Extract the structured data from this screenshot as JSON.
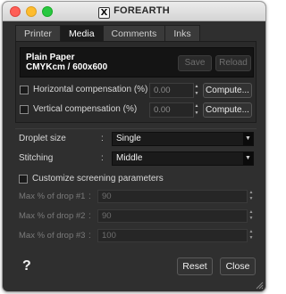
{
  "window": {
    "title": "FOREARTH",
    "logo_glyph": "X"
  },
  "tabs": [
    {
      "label": "Printer",
      "active": false
    },
    {
      "label": "Media",
      "active": true
    },
    {
      "label": "Comments",
      "active": false
    },
    {
      "label": "Inks",
      "active": false
    }
  ],
  "media": {
    "name": "Plain Paper",
    "mode": "CMYKcm / 600x600",
    "save_label": "Save",
    "reload_label": "Reload"
  },
  "compensation": {
    "horizontal": {
      "label": "Horizontal compensation (%)",
      "value": "0.00",
      "checked": false,
      "compute_label": "Compute..."
    },
    "vertical": {
      "label": "Vertical compensation (%)",
      "value": "0.00",
      "checked": false,
      "compute_label": "Compute..."
    }
  },
  "settings": {
    "droplet_size": {
      "label": "Droplet size",
      "colon": ":",
      "value": "Single"
    },
    "stitching": {
      "label": "Stitching",
      "colon": ":",
      "value": "Middle"
    }
  },
  "screening": {
    "label": "Customize screening parameters",
    "checked": false,
    "drops": [
      {
        "label": "Max % of drop #1",
        "colon": ":",
        "value": "90"
      },
      {
        "label": "Max % of drop #2",
        "colon": ":",
        "value": "90"
      },
      {
        "label": "Max % of drop #3",
        "colon": ":",
        "value": "100"
      }
    ]
  },
  "footer": {
    "help_label": "?",
    "reset_label": "Reset",
    "close_label": "Close"
  },
  "colors": {
    "background": "#2f2f2f",
    "field": "#1a1a1a",
    "text": "#e6e6e6",
    "disabled_text": "#7a7a7a"
  },
  "icons": {
    "spin": "spinner-arrows-icon",
    "dropdown": "dropdown-arrow-icon",
    "resize": "resize-grip-icon"
  }
}
